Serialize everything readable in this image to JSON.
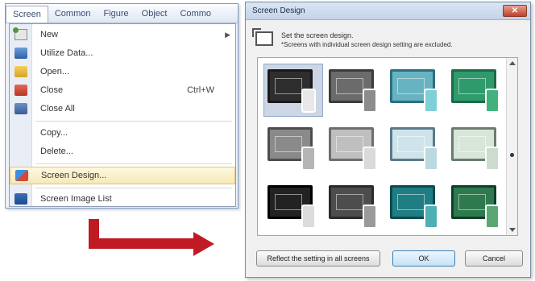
{
  "menubar": {
    "items": [
      "Screen",
      "Common",
      "Figure",
      "Object",
      "Commo"
    ]
  },
  "dropdown": {
    "items": [
      {
        "label": "New",
        "shortcut": "",
        "arrow": "▶",
        "icon": "new-screen-icon"
      },
      {
        "label": "Utilize Data...",
        "shortcut": "",
        "arrow": "",
        "icon": "utilize-data-icon"
      },
      {
        "label": "Open...",
        "shortcut": "",
        "arrow": "",
        "icon": "open-folder-icon"
      },
      {
        "label": "Close",
        "shortcut": "Ctrl+W",
        "arrow": "",
        "icon": "close-screen-icon"
      },
      {
        "label": "Close All",
        "shortcut": "",
        "arrow": "",
        "icon": "close-all-icon"
      },
      {
        "label": "Copy...",
        "shortcut": "",
        "arrow": "",
        "icon": ""
      },
      {
        "label": "Delete...",
        "shortcut": "",
        "arrow": "",
        "icon": ""
      },
      {
        "label": "Screen Design...",
        "shortcut": "",
        "arrow": "",
        "icon": "screen-design-icon"
      },
      {
        "label": "Screen Image List",
        "shortcut": "",
        "arrow": "",
        "icon": "screen-image-list-icon"
      }
    ]
  },
  "dialog": {
    "title": "Screen Design",
    "close_label": "✕",
    "info_line1": "Set the screen design.",
    "info_line2": "*Screens with individual screen design setting are excluded.",
    "themes": [
      {
        "monitor": "#1a1a1a",
        "screen": "#2e2e2e",
        "phone": "#e8e8e8"
      },
      {
        "monitor": "#3c3c3c",
        "screen": "#6b6b6b",
        "phone": "#8c8c8c"
      },
      {
        "monitor": "#2b6f80",
        "screen": "#67b3c1",
        "phone": "#7fcfd8"
      },
      {
        "monitor": "#1c6b4a",
        "screen": "#2f9a6b",
        "phone": "#41b27c"
      },
      {
        "monitor": "#4d4d4d",
        "screen": "#8a8a8a",
        "phone": "#b5b5b5"
      },
      {
        "monitor": "#6e6e6e",
        "screen": "#bfbfbf",
        "phone": "#dadada"
      },
      {
        "monitor": "#5a7a8a",
        "screen": "#cfe4ea",
        "phone": "#bcd9e2"
      },
      {
        "monitor": "#6a7c6e",
        "screen": "#d8e6da",
        "phone": "#cbdccd"
      },
      {
        "monitor": "#000000",
        "screen": "#222222",
        "phone": "#dcdcdc"
      },
      {
        "monitor": "#2a2a2a",
        "screen": "#4d4d4d",
        "phone": "#9a9a9a"
      },
      {
        "monitor": "#0f4a4e",
        "screen": "#1f7e83",
        "phone": "#4fb0b4"
      },
      {
        "monitor": "#0f3e2a",
        "screen": "#2e7a4e",
        "phone": "#59a874"
      }
    ],
    "buttons": {
      "reflect": "Reflect the setting in all screens",
      "ok": "OK",
      "cancel": "Cancel"
    }
  },
  "colors": {
    "arrow": "#c01a24",
    "selection_highlight": "#f6e9b8"
  }
}
